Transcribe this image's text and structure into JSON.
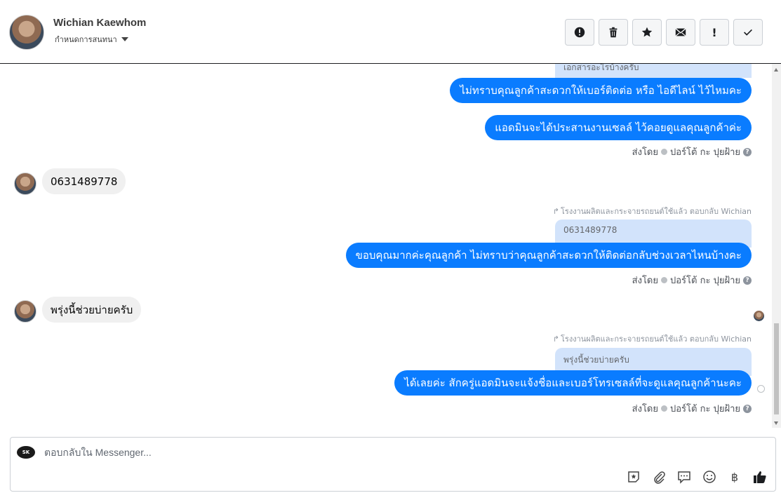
{
  "header": {
    "name": "Wichian Kaewhom",
    "subtitle": "กำหนดการสนทนา",
    "toolbar": [
      {
        "icon": "alert-circle-icon"
      },
      {
        "icon": "trash-icon"
      },
      {
        "icon": "star-icon"
      },
      {
        "icon": "envelope-icon"
      },
      {
        "icon": "exclamation-icon",
        "label": "!"
      },
      {
        "icon": "checkmark-icon"
      }
    ]
  },
  "thread": {
    "top_quote_partial": "เอกสารอะไรบ้างครับ",
    "msg1": "ไม่ทราบคุณลูกค้าสะดวกให้เบอร์ติดต่อ หรือ ไอดีไลน์ ไว้ไหมคะ",
    "msg2": "แอดมินจะได้ประสานงานเซลล์ ไว้คอยดูแลคุณลูกค้าค่ะ",
    "sent_by_1": "ส่งโดย",
    "sender_1": "ปอร์โต้ กะ ปุยฝ้าย",
    "in_msg1": "0631489778",
    "reply_line_1": "โรงงานผลิตและกระจายรถยนต์ใช้แล้ว ตอบกลับ Wichian",
    "quote_1": "0631489778",
    "msg3": "ขอบคุณมากค่ะคุณลูกค้า ไม่ทราบว่าคุณลูกค้าสะดวกให้ติดต่อกลับช่วงเวลาไหนบ้างคะ",
    "sent_by_2": "ส่งโดย",
    "sender_2": "ปอร์โต้ กะ ปุยฝ้าย",
    "in_msg2": "พรุ่งนี้ช่วยบ่ายครับ",
    "reply_line_2": "โรงงานผลิตและกระจายรถยนต์ใช้แล้ว ตอบกลับ Wichian",
    "quote_2": "พรุ่งนี้ช่วยบ่ายครับ",
    "msg4": "ได้เลยค่ะ สักครู่แอดมินจะแจ้งชื่อและเบอร์โทรเซลล์ที่จะดูแลคุณลูกค้านะคะ",
    "sent_by_3": "ส่งโดย",
    "sender_3": "ปอร์โต้ กะ ปุยฝ้าย"
  },
  "composer": {
    "placeholder": "ตอบกลับใน Messenger...",
    "page_avatar_text": "SK",
    "tools": [
      "sticker-icon",
      "attachment-icon",
      "saved-reply-icon",
      "emoji-icon",
      "baht-icon",
      "thumbs-up-icon"
    ],
    "baht_symbol": "฿"
  },
  "colors": {
    "outgoing_bubble": "#0a7cff",
    "incoming_bubble": "#f0f0f0",
    "quote_bg": "#d2e3fb"
  }
}
